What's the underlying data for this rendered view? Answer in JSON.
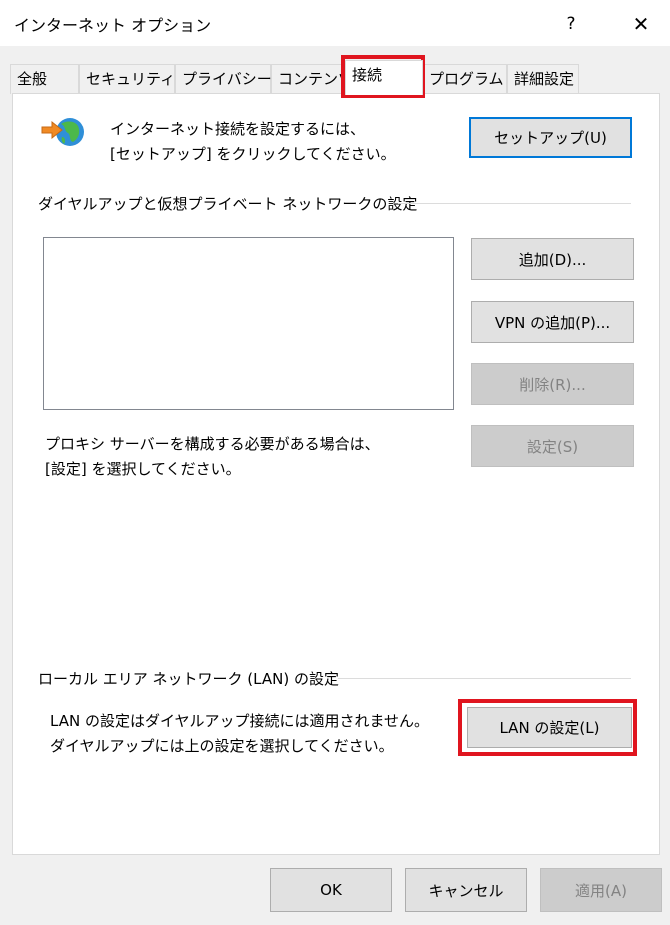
{
  "window": {
    "title": "インターネット オプション",
    "help_icon": "question-mark",
    "close_icon": "x-close"
  },
  "tabs": [
    {
      "label": "全般",
      "active": false
    },
    {
      "label": "セキュリティ",
      "active": false
    },
    {
      "label": "プライバシー",
      "active": false
    },
    {
      "label": "コンテンツ",
      "active": false
    },
    {
      "label": "接続",
      "active": true
    },
    {
      "label": "プログラム",
      "active": false
    },
    {
      "label": "詳細設定",
      "active": false
    }
  ],
  "setup": {
    "line1": "インターネット接続を設定するには、",
    "line2": "[セットアップ] をクリックしてください。",
    "button": "セットアップ(U)"
  },
  "dialup": {
    "group_title": "ダイヤルアップと仮想プライベート ネットワークの設定",
    "add_button": "追加(D)...",
    "add_vpn_button": "VPN の追加(P)...",
    "remove_button": "削除(R)...",
    "settings_button": "設定(S)",
    "proxy_line1": "プロキシ サーバーを構成する必要がある場合は、",
    "proxy_line2": "[設定] を選択してください。"
  },
  "lan": {
    "group_title": "ローカル エリア ネットワーク (LAN) の設定",
    "line1": "LAN の設定はダイヤルアップ接続には適用されません。",
    "line2": "ダイヤルアップには上の設定を選択してください。",
    "button": "LAN の設定(L)"
  },
  "footer": {
    "ok": "OK",
    "cancel": "キャンセル",
    "apply": "適用(A)"
  },
  "highlight_color": "#e0151f"
}
